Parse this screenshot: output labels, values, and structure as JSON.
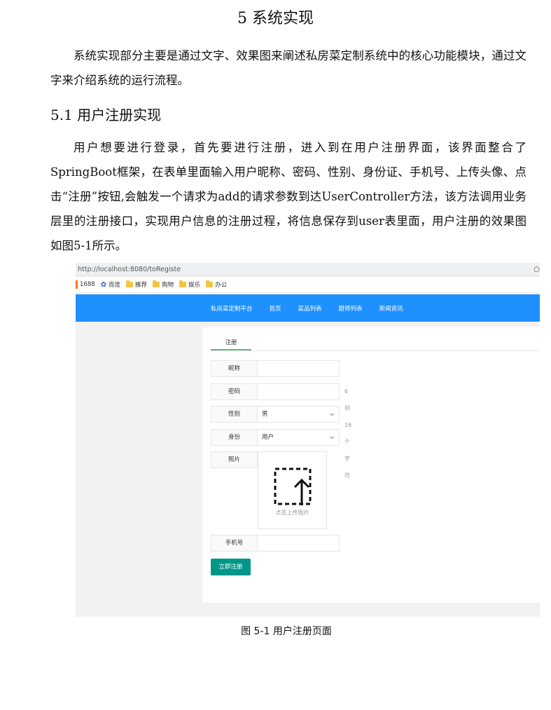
{
  "doc": {
    "heading": "5 系统实现",
    "intro": "系统实现部分主要是通过文字、效果图来阐述私房菜定制系统中的核心功能模块，通过文字来介绍系统的运行流程。",
    "section_heading": "5.1 用户注册实现",
    "section_body": "用户想要进行登录，首先要进行注册，进入到在用户注册界面，该界面整合了SpringBoot框架，在表单里面输入用户昵称、密码、性别、身份证、手机号、上传头像、点击“注册”按钮,会触发一个请求为add的请求参数到达UserController方法，该方法调用业务层里的注册接口，实现用户信息的注册过程，将信息保存到user表里面，用户注册的效果图如图5-1所示。",
    "caption": "图 5-1 用户注册页面"
  },
  "screenshot": {
    "url": "http://localhost:8080/toRegiste",
    "bookmarks": [
      "1688",
      "百度",
      "推荐",
      "购物",
      "娱乐",
      "办公"
    ],
    "nav": [
      "私房菜定制平台",
      "首页",
      "菜品列表",
      "厨师列表",
      "新闻资讯"
    ],
    "tab": "注册",
    "form": {
      "nickname_label": "昵称",
      "password_label": "密码",
      "password_hint": "6到16个字符",
      "gender_label": "性别",
      "gender_value": "男",
      "identity_label": "身份",
      "identity_value": "用户",
      "photo_label": "照片",
      "upload_text": "点击上传图片",
      "phone_label": "手机号",
      "submit": "立即注册"
    }
  },
  "colors": {
    "nav": "#1e90ff",
    "submit": "#009688",
    "tab_accent": "#5fb878"
  }
}
